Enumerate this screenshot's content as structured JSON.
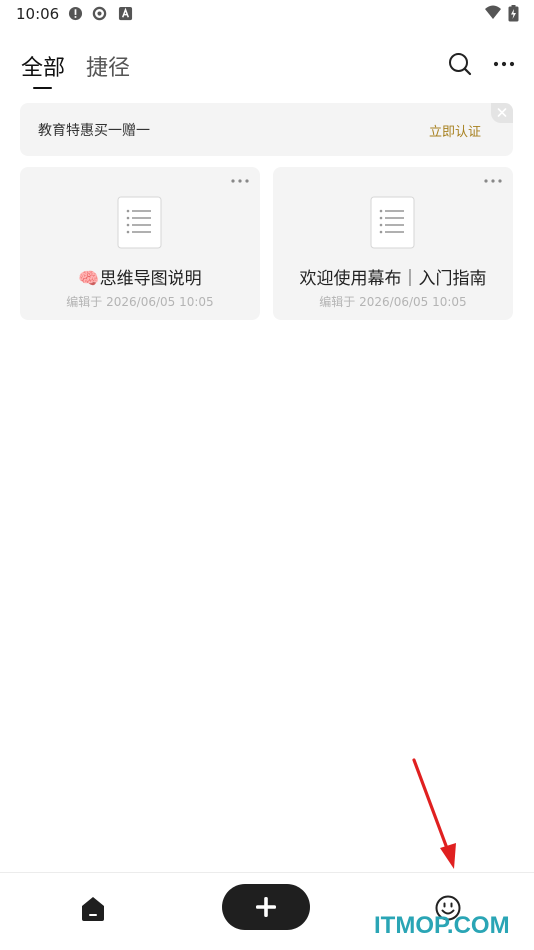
{
  "status_bar": {
    "time": "10:06",
    "icons_left": [
      "alert-icon",
      "sync-icon",
      "app-a-icon"
    ],
    "icons_right": [
      "wifi-icon",
      "battery-charging-icon"
    ]
  },
  "header": {
    "tabs": [
      {
        "label": "全部",
        "active": true
      },
      {
        "label": "捷径",
        "active": false
      }
    ],
    "actions": [
      "search-icon",
      "more-icon"
    ]
  },
  "promo": {
    "text": "教育特惠买一赠一",
    "action_label": "立即认证",
    "accent": "#a7801f"
  },
  "documents": [
    {
      "title": "🧠思维导图说明",
      "edited": "编辑于 2026/06/05 10:05"
    },
    {
      "title": "欢迎使用幕布｜入门指南",
      "edited": "编辑于 2026/06/05 10:05"
    }
  ],
  "bottom_nav": {
    "items": [
      "home-icon",
      "add-icon",
      "profile-icon"
    ]
  },
  "watermark": {
    "text": "ITMOP.COM",
    "color": "#2aa5b5"
  },
  "annotation": {
    "type": "red-arrow",
    "points_to": "profile-icon",
    "color": "#e02020"
  }
}
